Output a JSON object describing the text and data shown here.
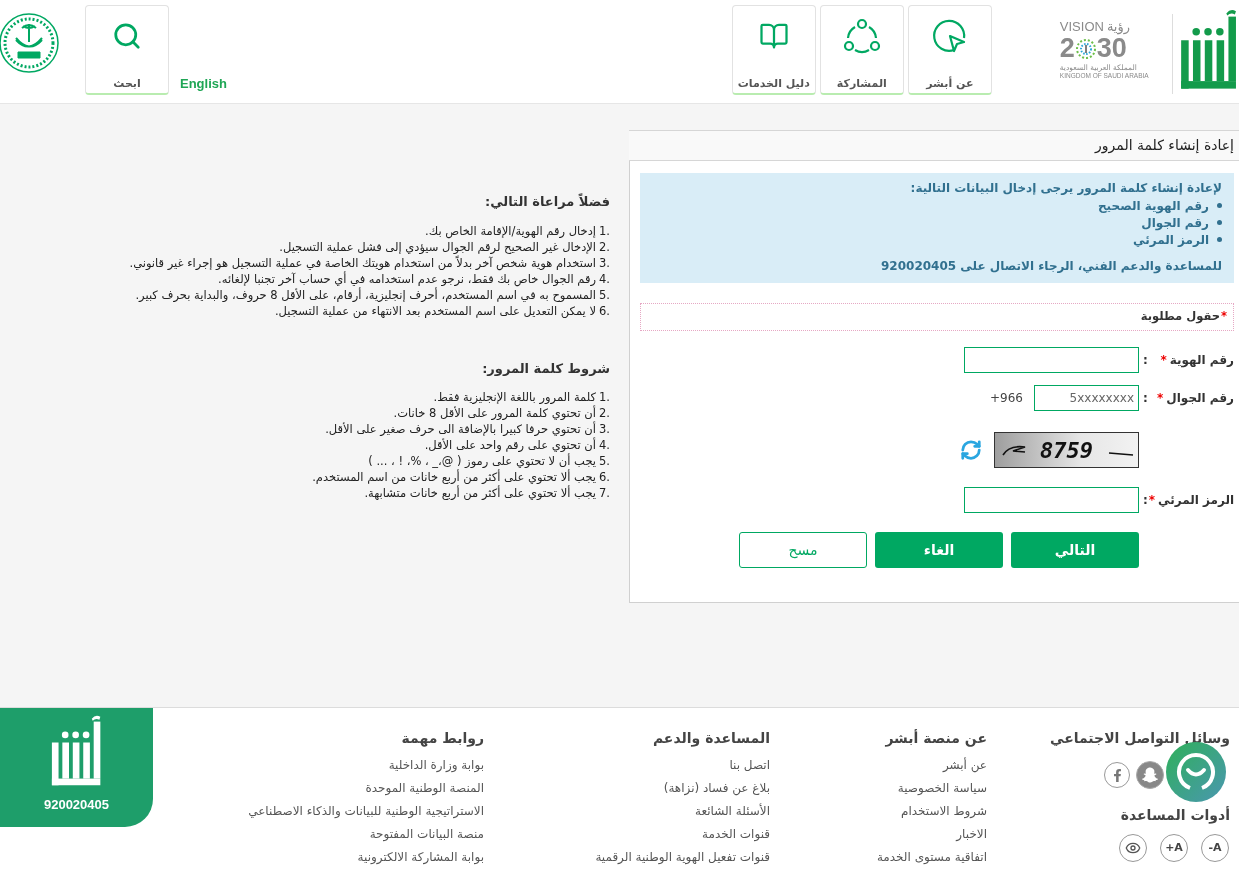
{
  "header": {
    "search_tile": {
      "label": "ابحث"
    },
    "language_link": "English",
    "nav_tiles": [
      {
        "label": "عن أبشر",
        "kind": "pointer"
      },
      {
        "label": "المشاركة",
        "kind": "share"
      },
      {
        "label": "دليل الخدمات",
        "kind": "book"
      }
    ],
    "vision_logo": {
      "word_en": "VISION",
      "word_ar": "رؤية",
      "year_start": "2",
      "year_end": "30",
      "country_ar": "المملكة العربية السعودية",
      "country_en": "KINGDOM OF SAUDI ARABIA"
    }
  },
  "notes": [
    {
      "title": "فضلاً مراعاة التالي:",
      "items": [
        {
          "number": "1.",
          "text": "إدخال رقم الهوية/الإقامة الخاص بك."
        },
        {
          "number": "2.",
          "text": "الإدخال غير الصحيح لرقم الجوال سيؤدي إلى فشل عملية التسجيل."
        },
        {
          "number": "3.",
          "text": "استخدام هوية شخص آخر بدلاً من استخدام هويتك الخاصة في عملية التسجيل هو إجراء غير قانوني."
        },
        {
          "number": "4.",
          "text": "رقم الجوال خاص بك فقط، نرجو عدم استخدامه في أي حساب آخر تجنبا لإلغائه."
        },
        {
          "number": "5.",
          "text": "المسموح به في اسم المستخدم، أحرف إنجليزية، أرقام، على الأقل 8 حروف، والبداية بحرف كبير."
        },
        {
          "number": "6.",
          "text": "لا يمكن التعديل على اسم المستخدم بعد الانتهاء من عملية التسجيل."
        }
      ]
    },
    {
      "title": "شروط كلمة المرور:",
      "items": [
        {
          "number": "1.",
          "text": "كلمة المرور باللغة الإنجليزية فقط."
        },
        {
          "number": "2.",
          "text": "أن تحتوي كلمة المرور على الأقل 8 خانات."
        },
        {
          "number": "3.",
          "text": "أن تحتوي حرفا كبيرا بالإضافة الى حرف صغير على الأقل."
        },
        {
          "number": "4.",
          "text": "أن تحتوي على رقم واحد على الأقل."
        },
        {
          "number": "5.",
          "text": "يجب أن لا تحتوي على رموز ( @،_ ، %، ! ، ... )"
        },
        {
          "number": "6.",
          "text": "يجب ألا تحتوي على أكثر من أربع خانات من اسم المستخدم."
        },
        {
          "number": "7.",
          "text": "يجب ألا تحتوي على أكثر من أربع خانات متشابهة."
        }
      ]
    }
  ],
  "panel": {
    "title": "إعادة إنشاء كلمة المرور",
    "info": {
      "intro": "لإعادة إنشاء كلمة المرور يرجى إدخال البيانات التالية:",
      "bullets": [
        "رقم الهوية الصحيح",
        "رقم الجوال",
        "الرمز المرئي"
      ],
      "support": "للمساعدة والدعم الفني، الرجاء الاتصال على 920020405"
    },
    "required_note": {
      "star": "*",
      "text": "حقول مطلوبة"
    },
    "fields": [
      {
        "kind": "text",
        "label": "رقم الهوية",
        "star": "*",
        "colon": ":"
      },
      {
        "kind": "phone",
        "label": "رقم الجوال",
        "star": "*",
        "colon": ":",
        "placeholder": "5xxxxxxxx",
        "prefix": "+966"
      },
      {
        "kind": "captcha",
        "code": "8759"
      },
      {
        "kind": "text",
        "label": "الرمز المرئي",
        "star": "*",
        "colon": ":"
      }
    ],
    "buttons": [
      {
        "label": "التالي",
        "kind": "primary"
      },
      {
        "label": "الغاء",
        "kind": "primary"
      },
      {
        "label": "مسح",
        "kind": "outline"
      }
    ]
  },
  "footer": {
    "social": {
      "title": "وسائل التواصل الاجتماعي",
      "icons": [
        {
          "kind": "snapchat"
        },
        {
          "kind": "facebook"
        }
      ]
    },
    "accessibility": {
      "title": "أدوات المساعدة",
      "buttons": [
        {
          "kind": "text",
          "label": "-A"
        },
        {
          "kind": "text",
          "label": "+A"
        },
        {
          "kind": "eye"
        }
      ]
    },
    "columns": [
      {
        "title": "عن منصة أبشر",
        "links": [
          "عن أبشر",
          "سياسة الخصوصية",
          "شروط الاستخدام",
          "الاخبار",
          "اتفاقية مستوى الخدمة"
        ]
      },
      {
        "title": "المساعدة والدعم",
        "links": [
          "اتصل بنا",
          "بلاغ عن فساد (نزاهة)",
          "الأسئلة الشائعة",
          "قنوات الخدمة",
          "قنوات تفعيل الهوية الوطنية الرقمية"
        ]
      },
      {
        "title": "روابط مهمة",
        "links": [
          "بوابة وزارة الداخلية",
          "المنصة الوطنية الموحدة",
          "الاستراتيجية الوطنية للبيانات والذكاء الاصطناعي",
          "منصة البيانات المفتوحة",
          "بوابة المشاركة الالكترونية"
        ]
      }
    ],
    "brand": {
      "phone": "920020405"
    }
  }
}
